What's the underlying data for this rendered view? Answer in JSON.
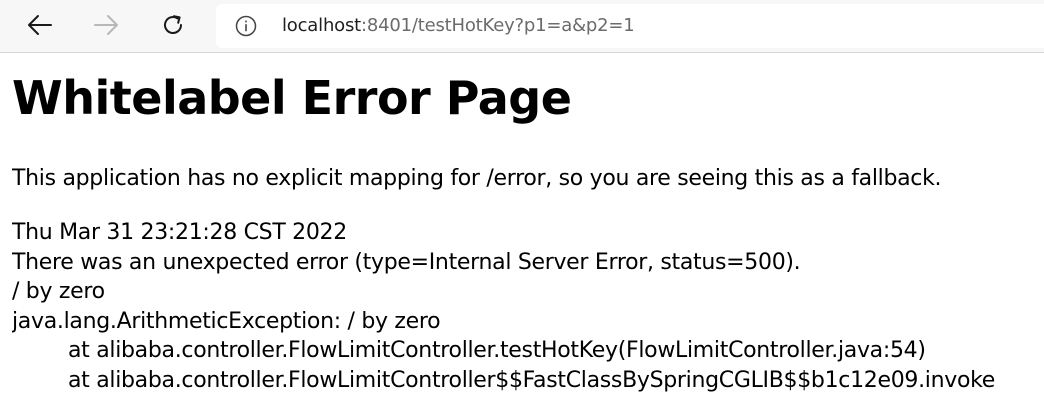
{
  "browser": {
    "url_host": "localhost",
    "url_rest": ":8401/testHotKey?p1=a&p2=1",
    "icons": {
      "back": "arrow-left-icon",
      "forward": "arrow-right-icon",
      "reload": "reload-icon",
      "site_info": "info-icon"
    }
  },
  "page": {
    "title": "Whitelabel Error Page",
    "message": "This application has no explicit mapping for /error, so you are seeing this as a fallback.",
    "timestamp": "Thu Mar 31 23:21:28 CST 2022",
    "error_summary": "There was an unexpected error (type=Internal Server Error, status=500).",
    "error_message": "/ by zero",
    "exception": "java.lang.ArithmeticException: / by zero",
    "stack_frames": [
      "at alibaba.controller.FlowLimitController.testHotKey(FlowLimitController.java:54)",
      "at alibaba.controller.FlowLimitController$$FastClassBySpringCGLIB$$b1c12e09.invoke"
    ]
  }
}
